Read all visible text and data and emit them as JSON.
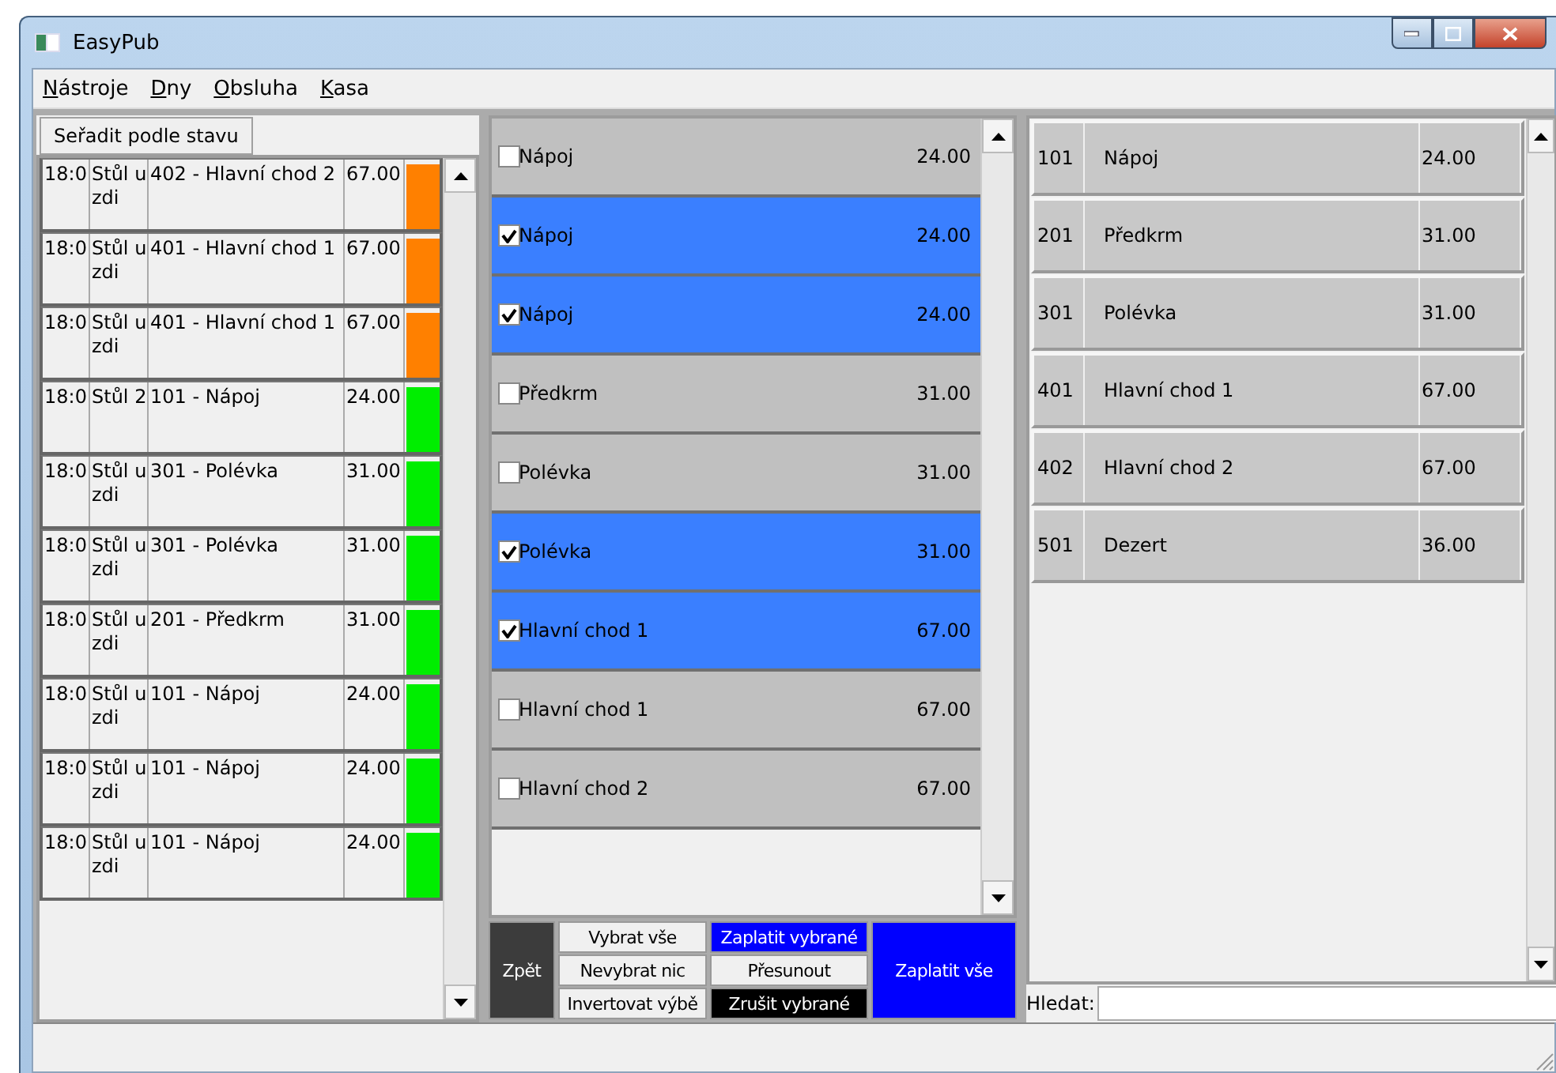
{
  "window": {
    "title": "EasyPub"
  },
  "menu": [
    {
      "label": "Nástroje"
    },
    {
      "label": "Dny"
    },
    {
      "label": "Obsluha"
    },
    {
      "label": "Kasa"
    }
  ],
  "orders": {
    "sort_button": "Seřadit podle stavu",
    "rows": [
      {
        "time": "18:0",
        "table": "Stůl u zdi",
        "item": "402 - Hlavní chod 2",
        "price": "67.00",
        "color": "#ff8000"
      },
      {
        "time": "18:0",
        "table": "Stůl u zdi",
        "item": "401 - Hlavní chod 1",
        "price": "67.00",
        "color": "#ff8000"
      },
      {
        "time": "18:0",
        "table": "Stůl u zdi",
        "item": "401 - Hlavní chod 1",
        "price": "67.00",
        "color": "#ff8000"
      },
      {
        "time": "18:0",
        "table": "Stůl 2",
        "item": "101 - Nápoj",
        "price": "24.00",
        "color": "#00ee00"
      },
      {
        "time": "18:0",
        "table": "Stůl u zdi",
        "item": "301 - Polévka",
        "price": "31.00",
        "color": "#00ee00"
      },
      {
        "time": "18:0",
        "table": "Stůl u zdi",
        "item": "301 - Polévka",
        "price": "31.00",
        "color": "#00ee00"
      },
      {
        "time": "18:0",
        "table": "Stůl u zdi",
        "item": "201 - Předkrm",
        "price": "31.00",
        "color": "#00ee00"
      },
      {
        "time": "18:0",
        "table": "Stůl u zdi",
        "item": "101 - Nápoj",
        "price": "24.00",
        "color": "#00ee00"
      },
      {
        "time": "18:0",
        "table": "Stůl u zdi",
        "item": "101 - Nápoj",
        "price": "24.00",
        "color": "#00ee00"
      },
      {
        "time": "18:0",
        "table": "Stůl u zdi",
        "item": "101 - Nápoj",
        "price": "24.00",
        "color": "#00ee00"
      }
    ]
  },
  "bill": {
    "rows": [
      {
        "name": "Nápoj",
        "price": "24.00",
        "checked": false
      },
      {
        "name": "Nápoj",
        "price": "24.00",
        "checked": true
      },
      {
        "name": "Nápoj",
        "price": "24.00",
        "checked": true
      },
      {
        "name": "Předkrm",
        "price": "31.00",
        "checked": false
      },
      {
        "name": "Polévka",
        "price": "31.00",
        "checked": false
      },
      {
        "name": "Polévka",
        "price": "31.00",
        "checked": true
      },
      {
        "name": "Hlavní chod 1",
        "price": "67.00",
        "checked": true
      },
      {
        "name": "Hlavní chod 1",
        "price": "67.00",
        "checked": false
      },
      {
        "name": "Hlavní chod 2",
        "price": "67.00",
        "checked": false
      }
    ],
    "back_button": "Zpět",
    "buttons": [
      {
        "label": "Vybrat vše",
        "kind": "plain"
      },
      {
        "label": "Zaplatit vybrané",
        "kind": "blue"
      },
      {
        "label": "Nevybrat nic",
        "kind": "plain"
      },
      {
        "label": "Přesunout",
        "kind": "plain"
      },
      {
        "label": "Invertovat výbě",
        "kind": "plain"
      },
      {
        "label": "Zrušit vybrané",
        "kind": "black"
      }
    ],
    "pay_all_button": "Zaplatit vše"
  },
  "menu_items": {
    "rows": [
      {
        "code": "101",
        "name": "Nápoj",
        "price": "24.00"
      },
      {
        "code": "201",
        "name": "Předkrm",
        "price": "31.00"
      },
      {
        "code": "301",
        "name": "Polévka",
        "price": "31.00"
      },
      {
        "code": "401",
        "name": "Hlavní chod 1",
        "price": "67.00"
      },
      {
        "code": "402",
        "name": "Hlavní chod 2",
        "price": "67.00"
      },
      {
        "code": "501",
        "name": "Dezert",
        "price": "36.00"
      }
    ],
    "search_label": "Hledat:"
  }
}
